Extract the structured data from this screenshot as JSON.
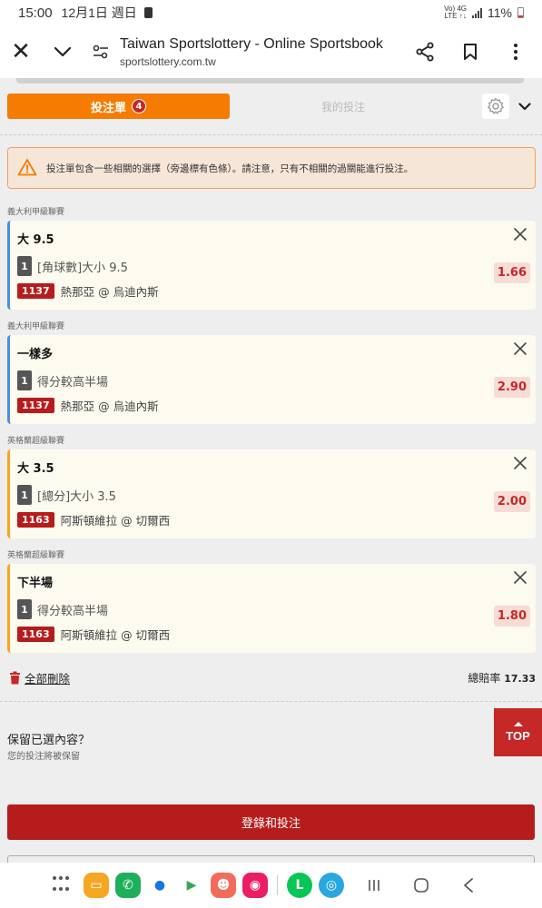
{
  "status_bar": {
    "time": "15:00",
    "date": "12月1日 週日",
    "network_top": "Vo) 4G",
    "network_bottom": "LTE ↑↓",
    "battery": "11%"
  },
  "browser": {
    "title": "Taiwan Sportslottery - Online Sportsbook",
    "url": "sportslottery.com.tw"
  },
  "tabs": {
    "betslip_label": "投注單",
    "betslip_count": "4",
    "my_bets_label": "我的投注"
  },
  "warning": {
    "text": "投注單包含一些相關的選擇（旁邊標有色條）。請注意，只有不相關的過關能進行投注。"
  },
  "bets": [
    {
      "league": "義大利甲級聯賽",
      "title": "大 9.5",
      "leg": "1",
      "market": "[角球數]大小 9.5",
      "match_id": "1137",
      "match": "熱那亞 @ 烏迪內斯",
      "odds": "1.66",
      "color": "#4a90d9"
    },
    {
      "league": "義大利甲級聯賽",
      "title": "一樣多",
      "leg": "1",
      "market": "得分較高半場",
      "match_id": "1137",
      "match": "熱那亞 @ 烏迪內斯",
      "odds": "2.90",
      "color": "#4a90d9"
    },
    {
      "league": "英格蘭超級聯賽",
      "title": "大 3.5",
      "leg": "1",
      "market": "[總分]大小 3.5",
      "match_id": "1163",
      "match": "阿斯頓維拉 @ 切爾西",
      "odds": "2.00",
      "color": "#f5a623"
    },
    {
      "league": "英格蘭超級聯賽",
      "title": "下半場",
      "leg": "1",
      "market": "得分較高半場",
      "match_id": "1163",
      "match": "阿斯頓維拉 @ 切爾西",
      "odds": "1.80",
      "color": "#f5a623"
    }
  ],
  "footer": {
    "delete_all": "全部刪除",
    "total_odds_label": "總賠率",
    "total_odds_value": "17.33"
  },
  "keep": {
    "title": "保留已選內容？",
    "subtitle": "您的投注將被保留"
  },
  "top_button": "TOP",
  "login_button": "登錄和投注",
  "colors": {
    "accent_orange": "#f57c00",
    "brand_red": "#b71c1c",
    "related_blue": "#4a90d9",
    "related_orange": "#f5a623"
  }
}
